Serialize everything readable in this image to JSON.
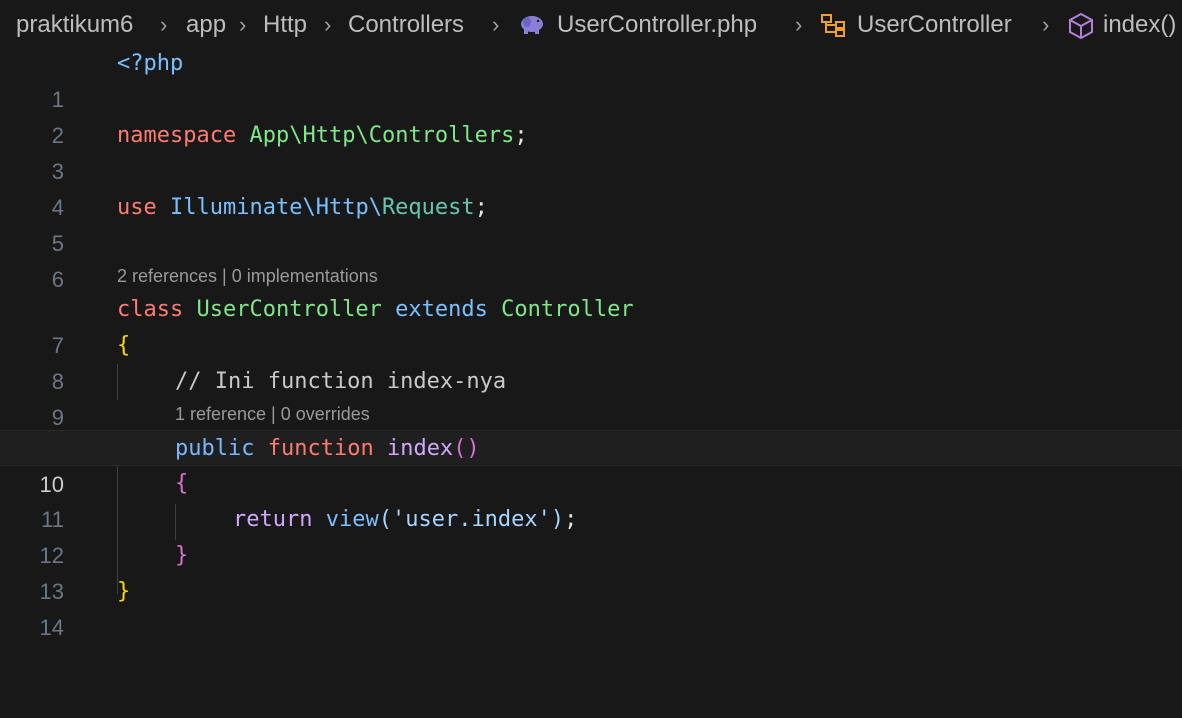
{
  "breadcrumb": {
    "items": [
      "praktikum6",
      "app",
      "Http",
      "Controllers",
      "UserController.php",
      "UserController",
      "index()"
    ],
    "file_icon": "php-elephant-icon",
    "class_icon": "class-symbol-icon",
    "method_icon": "method-cube-icon"
  },
  "editor": {
    "lines": [
      {
        "n": "1",
        "tokens": [
          "<?php"
        ]
      },
      {
        "n": "2",
        "tokens": []
      },
      {
        "n": "3",
        "tokens": [
          "namespace",
          " ",
          "App",
          "\\",
          "Http",
          "\\",
          "Controllers",
          ";"
        ]
      },
      {
        "n": "4",
        "tokens": []
      },
      {
        "n": "5",
        "tokens": [
          "use",
          " ",
          "Illuminate",
          "\\",
          "Http",
          "\\",
          "Request",
          ";"
        ]
      },
      {
        "n": "6",
        "tokens": []
      },
      {
        "n": "7",
        "tokens": [
          "class",
          " ",
          "UserController",
          " ",
          "extends",
          " ",
          "Controller"
        ]
      },
      {
        "n": "8",
        "tokens": [
          "{"
        ]
      },
      {
        "n": "9",
        "tokens": [
          "// Ini function index-nya"
        ]
      },
      {
        "n": "10",
        "tokens": [
          "public",
          " ",
          "function",
          " ",
          "index",
          "()"
        ]
      },
      {
        "n": "11",
        "tokens": [
          "{"
        ]
      },
      {
        "n": "12",
        "tokens": [
          "return",
          " ",
          "view",
          "(",
          "'user.index'",
          ")",
          ";"
        ]
      },
      {
        "n": "13",
        "tokens": [
          "}"
        ]
      },
      {
        "n": "14",
        "tokens": [
          "}"
        ]
      }
    ],
    "codelens_class": "2 references | 0 implementations",
    "codelens_method": "1 reference | 0 overrides",
    "current_line": "10"
  },
  "colors": {
    "background": "#181818",
    "keyword": "#ff7b72",
    "type": "#7ee787",
    "function_name": "#d2a8ff",
    "string": "#a5d6ff",
    "bracket_gold": "#ffd700",
    "bracket_magenta": "#da70d6"
  }
}
